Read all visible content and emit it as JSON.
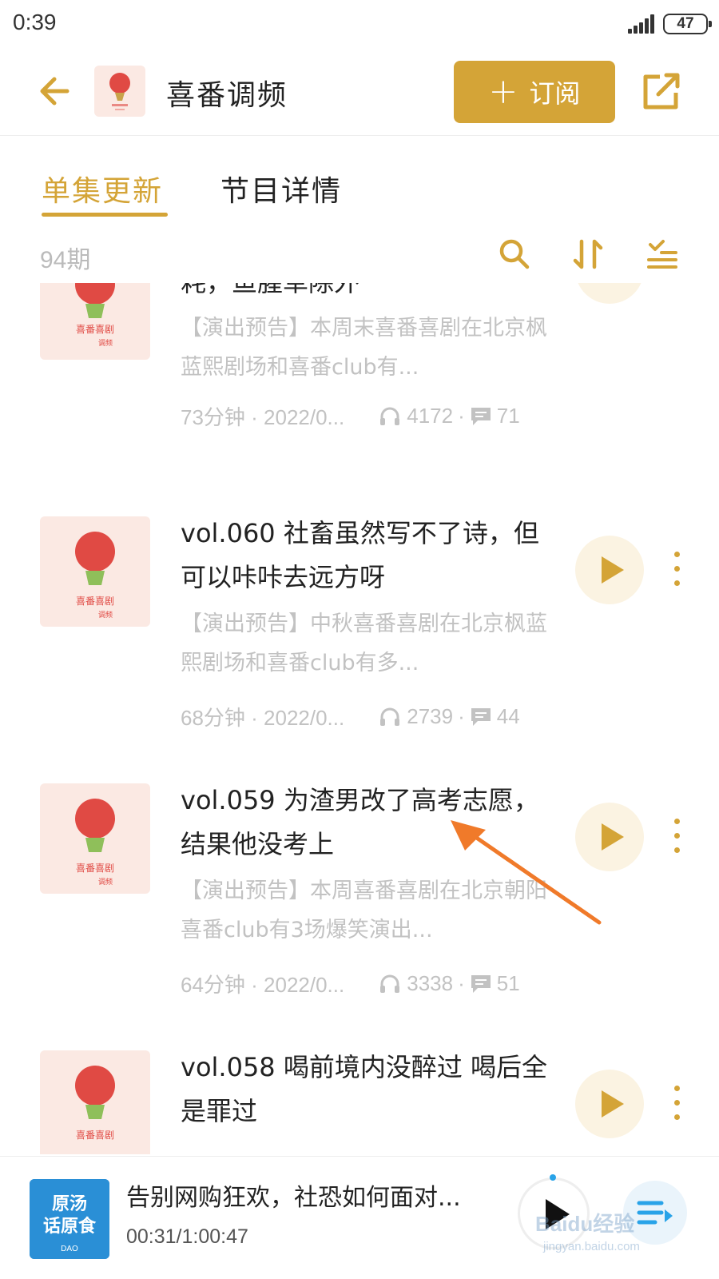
{
  "status_bar": {
    "time": "0:39",
    "battery": "47"
  },
  "header": {
    "podcast_title": "喜番调频",
    "subscribe_label": "订阅"
  },
  "tabs": [
    {
      "label": "单集更新",
      "active": true
    },
    {
      "label": "节目详情",
      "active": false
    }
  ],
  "list_header": {
    "episode_count": "94期"
  },
  "cover_text": {
    "line1": "喜番喜剧",
    "line2": "调频"
  },
  "episodes": [
    {
      "title": "耗，鱼腥草除外",
      "description": "【演出预告】本周末喜番喜剧在北京枫蓝熙剧场和喜番club有...",
      "duration_date": "73分钟 · 2022/0...",
      "plays": "4172",
      "comments": "71"
    },
    {
      "title": "vol.060 社畜虽然写不了诗，但可以咔咔去远方呀",
      "description": "【演出预告】中秋喜番喜剧在北京枫蓝熙剧场和喜番club有多...",
      "duration_date": "68分钟 · 2022/0...",
      "plays": "2739",
      "comments": "44"
    },
    {
      "title": "vol.059 为渣男改了高考志愿，结果他没考上",
      "description": "【演出预告】本周喜番喜剧在北京朝阳喜番club有3场爆笑演出...",
      "duration_date": "64分钟 · 2022/0...",
      "plays": "3338",
      "comments": "51"
    },
    {
      "title": "vol.058 喝前境内没醉过 喝后全是罪过"
    }
  ],
  "player": {
    "title": "告别网购狂欢，社恐如何面对...",
    "time": "00:31/1:00:47",
    "cover_text_line1": "原汤",
    "cover_text_line2": "话原食",
    "cover_text_line3": "DAO"
  },
  "watermark": {
    "brand": "Baidu经验",
    "url": "jingyan.baidu.com"
  },
  "colors": {
    "accent": "#d4a437",
    "annotation": "#f07a2a",
    "cover_bg": "#fbe9e3",
    "balloon": "#e04a44"
  }
}
